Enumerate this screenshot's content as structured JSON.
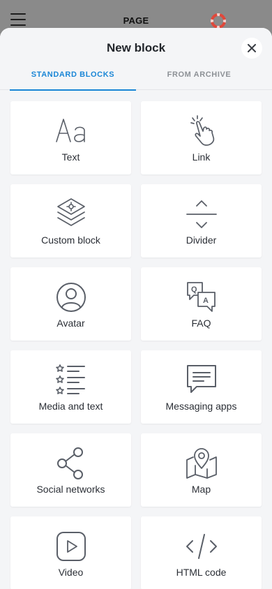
{
  "header": {
    "page_title": "PAGE"
  },
  "sheet": {
    "title": "New block",
    "tabs": [
      {
        "label": "STANDARD BLOCKS",
        "active": true
      },
      {
        "label": "FROM ARCHIVE",
        "active": false
      }
    ]
  },
  "blocks": [
    {
      "label": "Text",
      "icon": "text-icon"
    },
    {
      "label": "Link",
      "icon": "tap-hand-icon"
    },
    {
      "label": "Custom block",
      "icon": "layers-icon"
    },
    {
      "label": "Divider",
      "icon": "divider-icon"
    },
    {
      "label": "Avatar",
      "icon": "avatar-icon"
    },
    {
      "label": "FAQ",
      "icon": "faq-icon"
    },
    {
      "label": "Media and text",
      "icon": "media-list-icon"
    },
    {
      "label": "Messaging apps",
      "icon": "message-icon"
    },
    {
      "label": "Social networks",
      "icon": "share-icon"
    },
    {
      "label": "Map",
      "icon": "map-icon"
    },
    {
      "label": "Video",
      "icon": "video-icon"
    },
    {
      "label": "HTML code",
      "icon": "code-icon"
    }
  ],
  "colors": {
    "accent": "#1a86d6",
    "icon": "#5a5f68",
    "lifebuoy": "#e0483b"
  }
}
